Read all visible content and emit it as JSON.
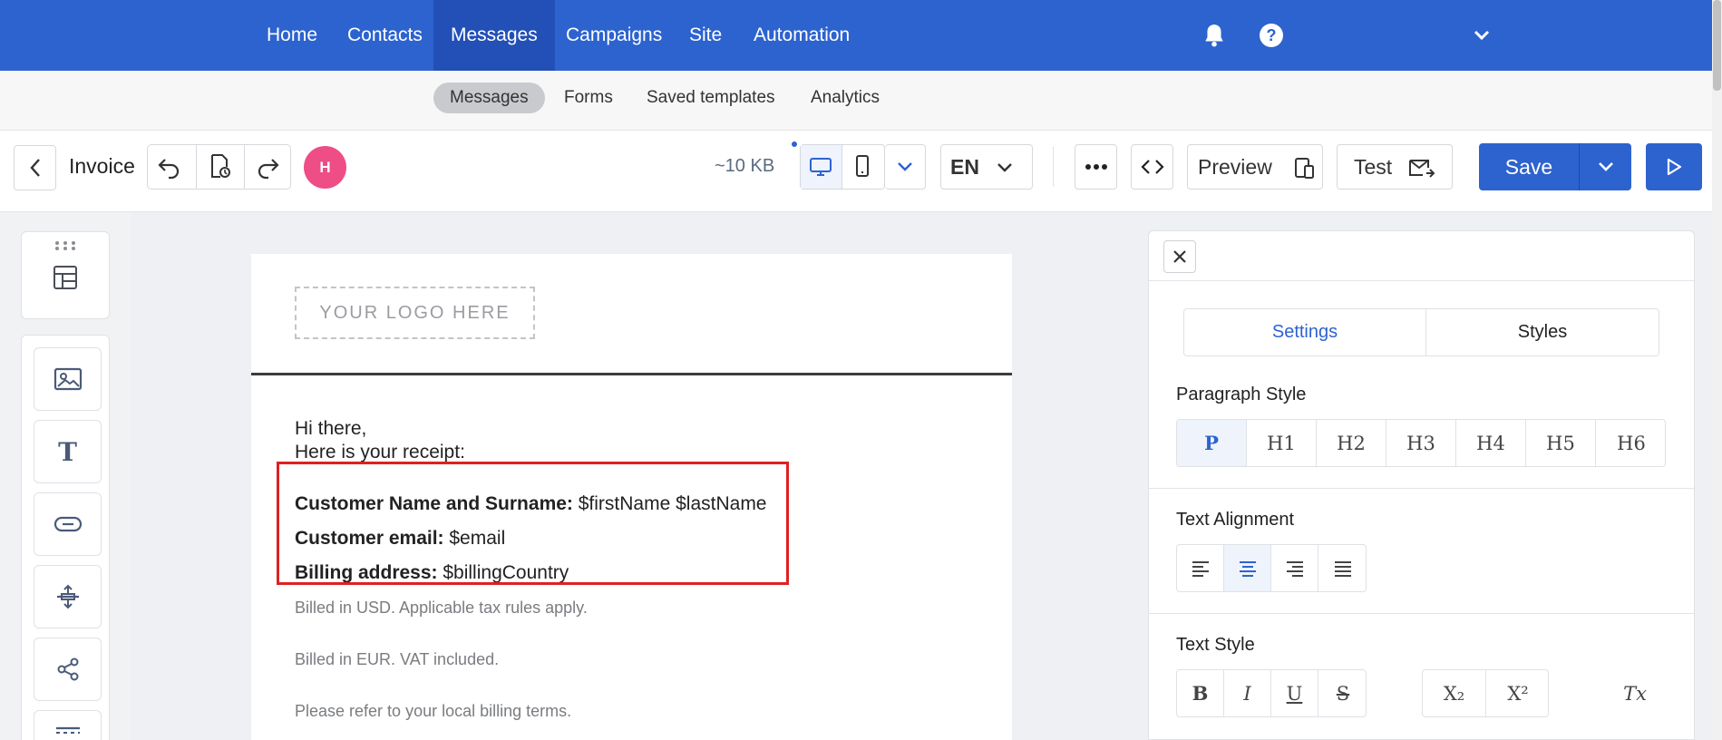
{
  "nav": {
    "items": [
      "Home",
      "Contacts",
      "Messages",
      "Campaigns",
      "Site",
      "Automation"
    ],
    "active": "Messages"
  },
  "subnav": {
    "items": [
      "Messages",
      "Forms",
      "Saved templates",
      "Analytics"
    ],
    "active": "Messages"
  },
  "toolbar": {
    "doc_title": "Invoice",
    "avatar_initial": "H",
    "size": "~10 KB",
    "language": "EN",
    "preview_label": "Preview",
    "test_label": "Test",
    "save_label": "Save"
  },
  "email": {
    "logo_placeholder": "YOUR LOGO HERE",
    "greeting": "Hi there,",
    "intro": "Here is your receipt:",
    "fields": [
      {
        "label": "Customer Name and Surname:",
        "value": " $firstName $lastName"
      },
      {
        "label": "Customer email:",
        "value": " $email"
      },
      {
        "label": "Billing address:",
        "value": " $billingCountry"
      }
    ],
    "notes": [
      "Billed in USD. Applicable tax rules apply.",
      "Billed in EUR. VAT included.",
      "Please refer to your local billing terms."
    ]
  },
  "panel": {
    "tabs": [
      "Settings",
      "Styles"
    ],
    "active_tab": "Settings",
    "paragraph_style_title": "Paragraph Style",
    "paragraph_styles": [
      "P",
      "H1",
      "H2",
      "H3",
      "H4",
      "H5",
      "H6"
    ],
    "text_alignment_title": "Text Alignment",
    "text_style_title": "Text Style",
    "text_styles": [
      "B",
      "I",
      "U",
      "S"
    ],
    "script_styles": [
      "X₂",
      "X²"
    ],
    "clear_format": "Tx"
  },
  "colors": {
    "brand": "#2d63cf",
    "highlight": "#e02020",
    "avatar": "#ee4d86"
  }
}
